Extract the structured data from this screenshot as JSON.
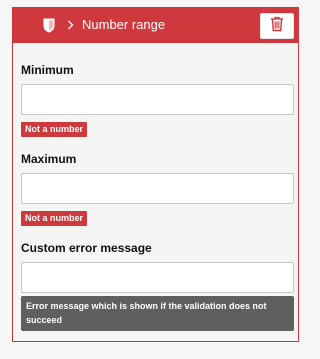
{
  "header": {
    "title": "Number range"
  },
  "fields": {
    "minimum": {
      "label": "Minimum",
      "value": "",
      "error": "Not a number"
    },
    "maximum": {
      "label": "Maximum",
      "value": "",
      "error": "Not a number"
    },
    "custom_error": {
      "label": "Custom error message",
      "value": "",
      "help": "Error message which is shown if the validation does not succeed"
    }
  },
  "colors": {
    "accent": "#cf383d",
    "help_bg": "#5f5f5d"
  },
  "icons": {
    "header": "shield-icon",
    "separator": "chevron-right-icon",
    "delete": "trash-icon"
  }
}
